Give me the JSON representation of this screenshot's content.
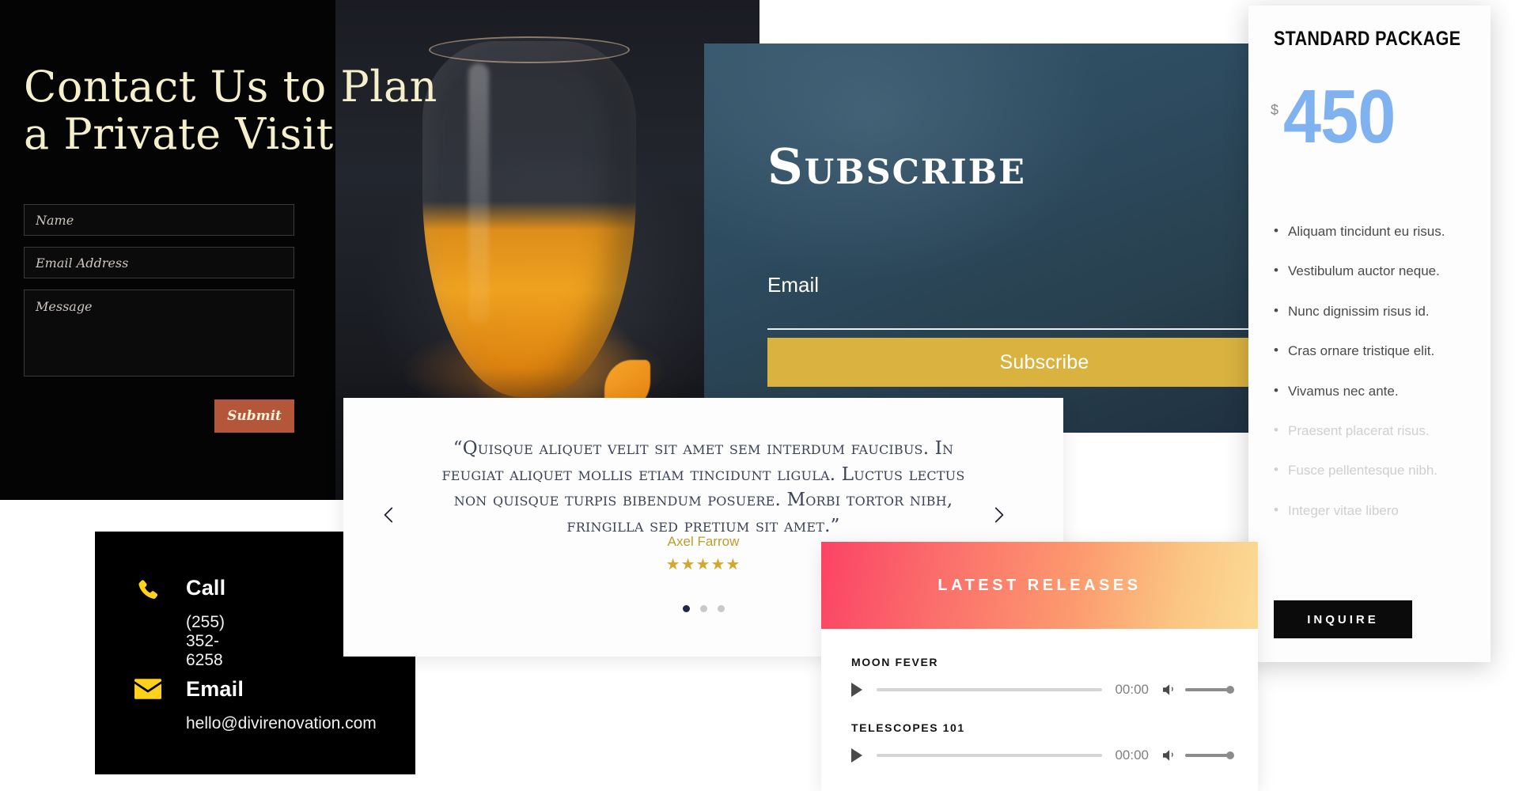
{
  "contact": {
    "title": "Contact Us to Plan a Private Visit",
    "name_placeholder": "Name",
    "email_placeholder": "Email Address",
    "message_placeholder": "Message",
    "submit_label": "Submit"
  },
  "contact_card": {
    "rows": [
      {
        "icon": "phone-icon",
        "title": "Call",
        "value": "(255) 352-6258"
      },
      {
        "icon": "envelope-icon",
        "title": "Email",
        "value": "hello@divirenovation.com"
      }
    ]
  },
  "subscribe": {
    "title": "Subscribe",
    "email_label": "Email",
    "email_value": "",
    "button_label": "Subscribe",
    "panel_color": "#2d4a5e",
    "button_color": "#D9B23F"
  },
  "pricing": {
    "title": "STANDARD PACKAGE",
    "currency": "$",
    "amount": "450",
    "price_color": "#7FB2EE",
    "features": [
      {
        "text": "Aliquam tincidunt eu risus.",
        "faded": false
      },
      {
        "text": "Vestibulum auctor neque.",
        "faded": false
      },
      {
        "text": "Nunc dignissim risus id.",
        "faded": false
      },
      {
        "text": "Cras ornare tristique elit.",
        "faded": false
      },
      {
        "text": "Vivamus nec ante.",
        "faded": false
      },
      {
        "text": "Praesent placerat risus.",
        "faded": true
      },
      {
        "text": "Fusce pellentesque nibh.",
        "faded": true
      },
      {
        "text": "Integer vitae libero",
        "faded": true
      }
    ],
    "cta_label": "INQUIRE"
  },
  "testimonial": {
    "quote": "“Quisque aliquet velit sit amet sem interdum faucibus. In feugiat aliquet mollis etiam tincidunt ligula. Luctus lectus non quisque turpis bibendum posuere. Morbi tortor nibh, fringilla sed pretium sit amet.”",
    "author": "Axel Farrow",
    "stars": "★★★★★",
    "star_color": "#D4A62A",
    "prev_icon": "chevron-left-icon",
    "next_icon": "chevron-right-icon",
    "dots": [
      {
        "active": true
      },
      {
        "active": false
      },
      {
        "active": false
      }
    ]
  },
  "releases": {
    "title": "LATEST RELEASES",
    "gradient_from": "#FB4365",
    "gradient_to": "#FBDB96",
    "tracks": [
      {
        "name": "MOON FEVER",
        "time": "00:00",
        "progress": 0,
        "volume": 100
      },
      {
        "name": "TELESCOPES 101",
        "time": "00:00",
        "progress": 0,
        "volume": 100
      }
    ]
  }
}
